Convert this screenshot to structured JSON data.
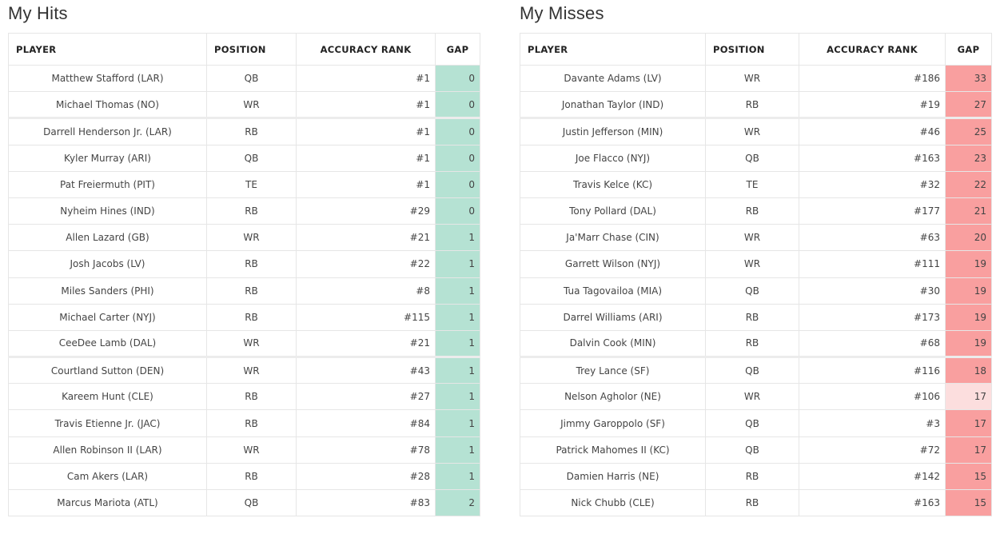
{
  "colors": {
    "hit_gap_bg": "#b5e2d3",
    "miss_gap_bg": "#f99f9f",
    "miss_gap_bg_light": "#fcdede"
  },
  "hits": {
    "title": "My Hits",
    "headers": {
      "player": "PLAYER",
      "position": "POSITION",
      "rank": "ACCURACY RANK",
      "gap": "GAP"
    },
    "rows": [
      {
        "player": "Matthew Stafford (LAR)",
        "position": "QB",
        "rank": "#1",
        "gap": "0"
      },
      {
        "player": "Michael Thomas (NO)",
        "position": "WR",
        "rank": "#1",
        "gap": "0"
      },
      {
        "player": "Darrell Henderson Jr. (LAR)",
        "position": "RB",
        "rank": "#1",
        "gap": "0"
      },
      {
        "player": "Kyler Murray (ARI)",
        "position": "QB",
        "rank": "#1",
        "gap": "0"
      },
      {
        "player": "Pat Freiermuth (PIT)",
        "position": "TE",
        "rank": "#1",
        "gap": "0"
      },
      {
        "player": "Nyheim Hines (IND)",
        "position": "RB",
        "rank": "#29",
        "gap": "0"
      },
      {
        "player": "Allen Lazard (GB)",
        "position": "WR",
        "rank": "#21",
        "gap": "1"
      },
      {
        "player": "Josh Jacobs (LV)",
        "position": "RB",
        "rank": "#22",
        "gap": "1"
      },
      {
        "player": "Miles Sanders (PHI)",
        "position": "RB",
        "rank": "#8",
        "gap": "1"
      },
      {
        "player": "Michael Carter (NYJ)",
        "position": "RB",
        "rank": "#115",
        "gap": "1"
      },
      {
        "player": "CeeDee Lamb (DAL)",
        "position": "WR",
        "rank": "#21",
        "gap": "1"
      },
      {
        "player": "Courtland Sutton (DEN)",
        "position": "WR",
        "rank": "#43",
        "gap": "1"
      },
      {
        "player": "Kareem Hunt (CLE)",
        "position": "RB",
        "rank": "#27",
        "gap": "1"
      },
      {
        "player": "Travis Etienne Jr. (JAC)",
        "position": "RB",
        "rank": "#84",
        "gap": "1"
      },
      {
        "player": "Allen Robinson II (LAR)",
        "position": "WR",
        "rank": "#78",
        "gap": "1"
      },
      {
        "player": "Cam Akers (LAR)",
        "position": "RB",
        "rank": "#28",
        "gap": "1"
      },
      {
        "player": "Marcus Mariota (ATL)",
        "position": "QB",
        "rank": "#83",
        "gap": "2"
      }
    ]
  },
  "misses": {
    "title": "My Misses",
    "headers": {
      "player": "PLAYER",
      "position": "POSITION",
      "rank": "ACCURACY RANK",
      "gap": "GAP"
    },
    "rows": [
      {
        "player": "Davante Adams (LV)",
        "position": "WR",
        "rank": "#186",
        "gap": "33",
        "highlight": "strong"
      },
      {
        "player": "Jonathan Taylor (IND)",
        "position": "RB",
        "rank": "#19",
        "gap": "27",
        "highlight": "strong"
      },
      {
        "player": "Justin Jefferson (MIN)",
        "position": "WR",
        "rank": "#46",
        "gap": "25",
        "highlight": "strong"
      },
      {
        "player": "Joe Flacco (NYJ)",
        "position": "QB",
        "rank": "#163",
        "gap": "23",
        "highlight": "strong"
      },
      {
        "player": "Travis Kelce (KC)",
        "position": "TE",
        "rank": "#32",
        "gap": "22",
        "highlight": "strong"
      },
      {
        "player": "Tony Pollard (DAL)",
        "position": "RB",
        "rank": "#177",
        "gap": "21",
        "highlight": "strong"
      },
      {
        "player": "Ja'Marr Chase (CIN)",
        "position": "WR",
        "rank": "#63",
        "gap": "20",
        "highlight": "strong"
      },
      {
        "player": "Garrett Wilson (NYJ)",
        "position": "WR",
        "rank": "#111",
        "gap": "19",
        "highlight": "strong"
      },
      {
        "player": "Tua Tagovailoa (MIA)",
        "position": "QB",
        "rank": "#30",
        "gap": "19",
        "highlight": "strong"
      },
      {
        "player": "Darrel Williams (ARI)",
        "position": "RB",
        "rank": "#173",
        "gap": "19",
        "highlight": "strong"
      },
      {
        "player": "Dalvin Cook (MIN)",
        "position": "RB",
        "rank": "#68",
        "gap": "19",
        "highlight": "strong"
      },
      {
        "player": "Trey Lance (SF)",
        "position": "QB",
        "rank": "#116",
        "gap": "18",
        "highlight": "strong"
      },
      {
        "player": "Nelson Agholor (NE)",
        "position": "WR",
        "rank": "#106",
        "gap": "17",
        "highlight": "light"
      },
      {
        "player": "Jimmy Garoppolo (SF)",
        "position": "QB",
        "rank": "#3",
        "gap": "17",
        "highlight": "strong"
      },
      {
        "player": "Patrick Mahomes II (KC)",
        "position": "QB",
        "rank": "#72",
        "gap": "17",
        "highlight": "strong"
      },
      {
        "player": "Damien Harris (NE)",
        "position": "RB",
        "rank": "#142",
        "gap": "15",
        "highlight": "strong"
      },
      {
        "player": "Nick Chubb (CLE)",
        "position": "RB",
        "rank": "#163",
        "gap": "15",
        "highlight": "strong"
      }
    ]
  }
}
